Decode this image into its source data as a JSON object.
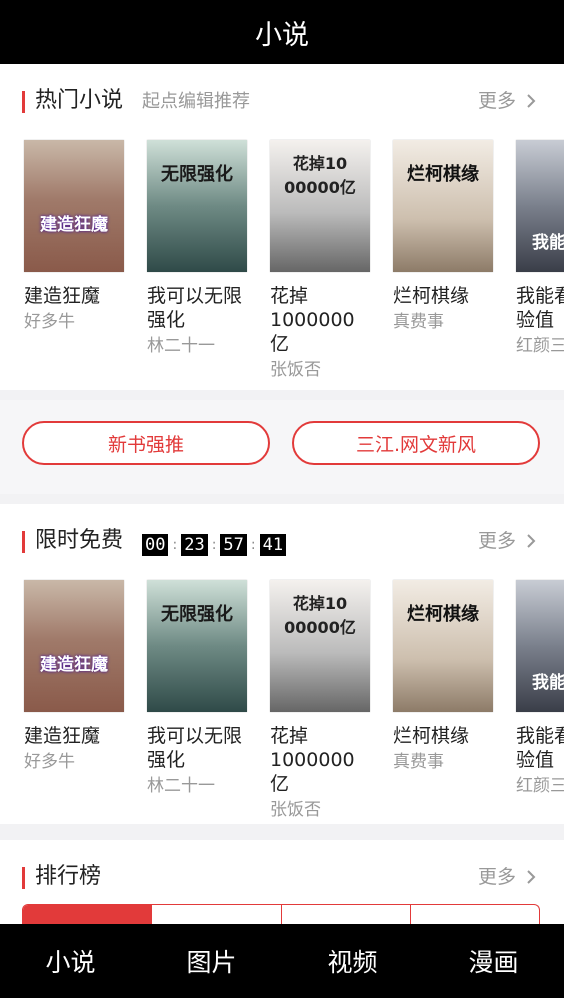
{
  "header": {
    "title": "小说"
  },
  "hot": {
    "title": "热门小说",
    "subtitle": "起点编辑推荐",
    "more": "更多",
    "books": [
      {
        "title": "建造狂魔",
        "author": "好多牛",
        "cover_text": "建造狂魔"
      },
      {
        "title": "我可以无限强化",
        "author": "林二十一",
        "cover_text": "无限强化"
      },
      {
        "title": "花掉1000000亿",
        "author": "张饭否",
        "cover_text": "花掉10 00000亿"
      },
      {
        "title": "烂柯棋缘",
        "author": "真费事",
        "cover_text": "烂柯棋缘"
      },
      {
        "title": "我能看见经验值",
        "author": "红颜三",
        "cover_text": "我能经验"
      }
    ]
  },
  "buttons": {
    "left": "新书强推",
    "right": "三江.网文新风"
  },
  "free": {
    "title": "限时免费",
    "more": "更多",
    "timer": {
      "h": "00",
      "m": "23",
      "s": "57",
      "f": "41"
    },
    "books": [
      {
        "title": "建造狂魔",
        "author": "好多牛",
        "cover_text": "建造狂魔"
      },
      {
        "title": "我可以无限强化",
        "author": "林二十一",
        "cover_text": "无限强化"
      },
      {
        "title": "花掉1000000亿",
        "author": "张饭否",
        "cover_text": "花掉10 00000亿"
      },
      {
        "title": "烂柯棋缘",
        "author": "真费事",
        "cover_text": "烂柯棋缘"
      },
      {
        "title": "我能看见经验值",
        "author": "红颜三",
        "cover_text": "我能经验"
      }
    ]
  },
  "rank": {
    "title": "排行榜",
    "more": "更多"
  },
  "bottom_nav": [
    "小说",
    "图片",
    "视频",
    "漫画"
  ],
  "colors": {
    "accent": "#e23a3a",
    "bar_bg": "#000000",
    "muted": "#999999"
  }
}
